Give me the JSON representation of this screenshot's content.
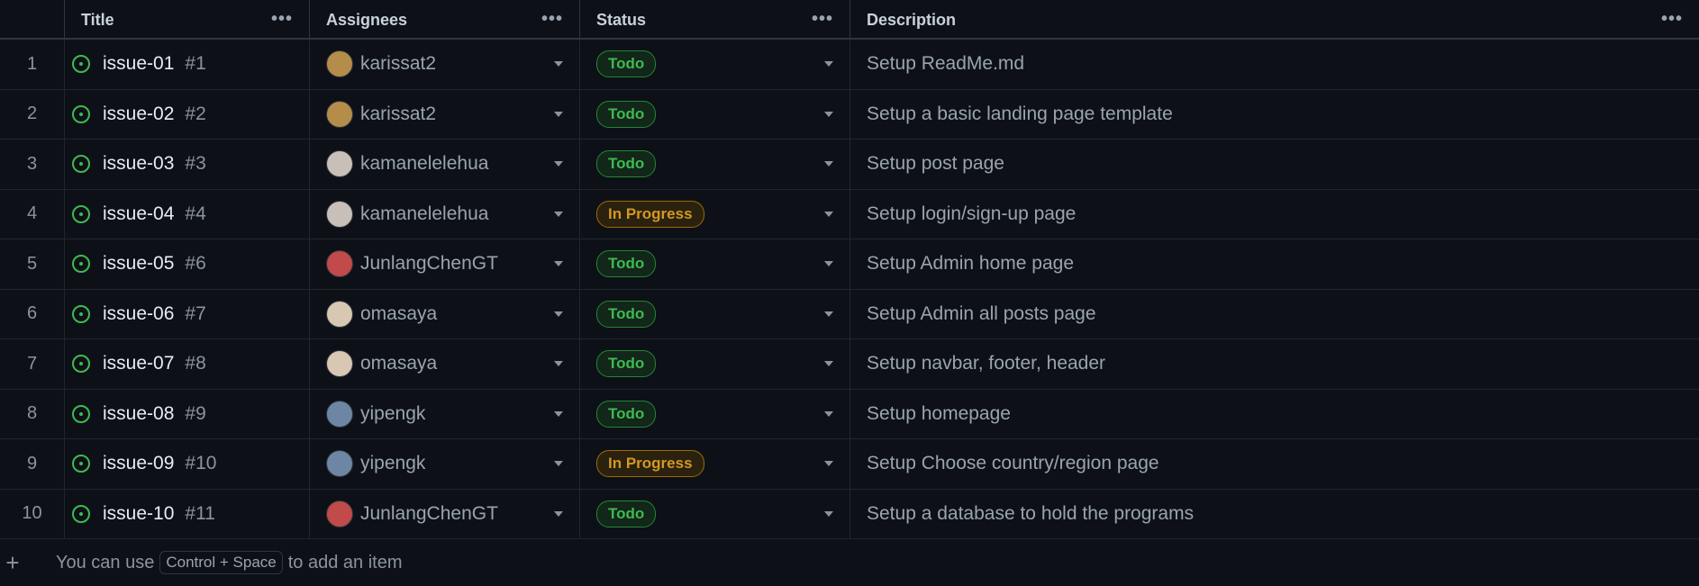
{
  "columns": {
    "title": "Title",
    "assignees": "Assignees",
    "status": "Status",
    "description": "Description",
    "menu": "•••"
  },
  "rows": [
    {
      "index": "1",
      "title": "issue-01",
      "num": "#1",
      "assignee": "karissat2",
      "status": "Todo",
      "desc": "Setup ReadMe.md",
      "avatar_color": "#b58d4a"
    },
    {
      "index": "2",
      "title": "issue-02",
      "num": "#2",
      "assignee": "karissat2",
      "status": "Todo",
      "desc": "Setup a basic landing page template",
      "avatar_color": "#b58d4a"
    },
    {
      "index": "3",
      "title": "issue-03",
      "num": "#3",
      "assignee": "kamanelelehua",
      "status": "Todo",
      "desc": "Setup post page",
      "avatar_color": "#c8c0b8"
    },
    {
      "index": "4",
      "title": "issue-04",
      "num": "#4",
      "assignee": "kamanelelehua",
      "status": "In Progress",
      "desc": "Setup login/sign-up page",
      "avatar_color": "#c8c0b8"
    },
    {
      "index": "5",
      "title": "issue-05",
      "num": "#6",
      "assignee": "JunlangChenGT",
      "status": "Todo",
      "desc": "Setup Admin home page",
      "avatar_color": "#c14a4a"
    },
    {
      "index": "6",
      "title": "issue-06",
      "num": "#7",
      "assignee": "omasaya",
      "status": "Todo",
      "desc": "Setup Admin all posts page",
      "avatar_color": "#d7c7b3"
    },
    {
      "index": "7",
      "title": "issue-07",
      "num": "#8",
      "assignee": "omasaya",
      "status": "Todo",
      "desc": "Setup navbar, footer, header",
      "avatar_color": "#d7c7b3"
    },
    {
      "index": "8",
      "title": "issue-08",
      "num": "#9",
      "assignee": "yipengk",
      "status": "Todo",
      "desc": "Setup homepage",
      "avatar_color": "#6d86a3"
    },
    {
      "index": "9",
      "title": "issue-09",
      "num": "#10",
      "assignee": "yipengk",
      "status": "In Progress",
      "desc": "Setup Choose country/region page",
      "avatar_color": "#6d86a3"
    },
    {
      "index": "10",
      "title": "issue-10",
      "num": "#11",
      "assignee": "JunlangChenGT",
      "status": "Todo",
      "desc": "Setup a database to hold the programs",
      "avatar_color": "#c14a4a"
    }
  ],
  "footer": {
    "plus": "+",
    "prefix": "You can use",
    "shortcut": "Control + Space",
    "suffix": "to add an item"
  }
}
